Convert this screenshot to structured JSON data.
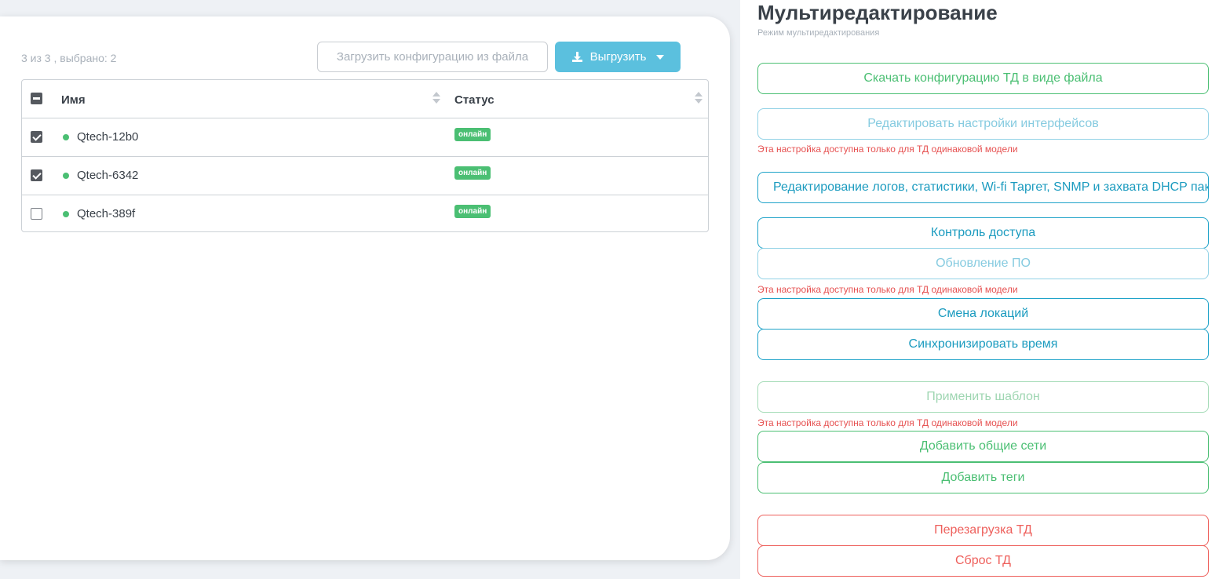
{
  "list": {
    "count_text": "3 из 3 , выбрано: 2",
    "load_button": "Загрузить конфигурацию из файла",
    "export_button": "Выгрузить",
    "columns": {
      "name": "Имя",
      "status": "Статус"
    },
    "rows": [
      {
        "name": "Qtech-12b0",
        "status": "онлайн",
        "checked": true
      },
      {
        "name": "Qtech-6342",
        "status": "онлайн",
        "checked": true
      },
      {
        "name": "Qtech-389f",
        "status": "онлайн",
        "checked": false
      }
    ]
  },
  "panel": {
    "title": "Мультиредактирование",
    "subtitle": "Режим мультиредактирования",
    "buttons": {
      "download_config": "Скачать конфигурацию ТД в виде файла",
      "edit_interfaces": "Редактировать настройки интерфейсов",
      "edit_logs": "Редактирование логов, статистики, Wi-fi Таргет, SNMP и захвата DHCP пакетов",
      "access_control": "Контроль доступа",
      "firmware_update": "Обновление ПО",
      "change_location": "Смена локаций",
      "sync_time": "Синхронизировать время",
      "apply_template": "Применить шаблон",
      "add_networks": "Добавить общие сети",
      "add_tags": "Добавить теги",
      "reboot": "Перезагрузка ТД",
      "reset": "Сброс ТД"
    },
    "same_model_note": "Эта настройка доступна только для ТД одинаковой модели"
  },
  "colors": {
    "accent": "#5bc0de",
    "online": "#4bbf73",
    "danger": "#ee5f5b"
  },
  "icons": [
    "download-icon",
    "caret-down-icon",
    "sort-icon",
    "status-dot-icon"
  ]
}
